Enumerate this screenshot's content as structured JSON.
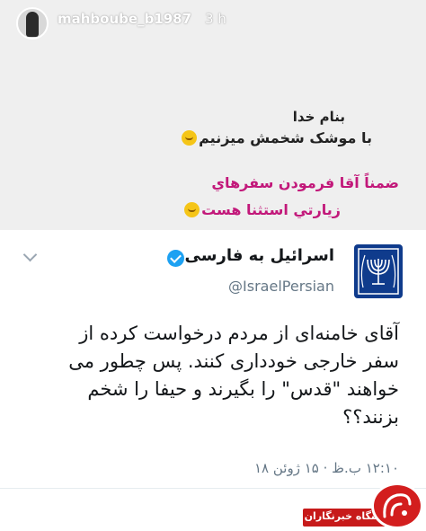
{
  "story": {
    "username": "mahboube_b1987",
    "time": "3 h"
  },
  "caption": {
    "line1": "بنام خدا",
    "line2": "با موشک شخمش میزنیم",
    "line3": "ضمناً آقا فرمودن سفرهاي",
    "line4": "زيارتي استثنا هست"
  },
  "tweet": {
    "name": "اسرائیل به فارسی",
    "handle": "@IsraelPersian",
    "body_lines": [
      "آقای خامنه‌ای از مردم درخواست کرده از",
      "سفر خارجی خودداری کنند. پس چطور می",
      "خواهند \"قدس\" را بگیرند و حیفا را شخم",
      "بزنند؟؟"
    ],
    "meta": "۱۲:۱۰ ب.ظ · ۱۵ ژوئن ۱۸"
  },
  "watermark": {
    "label": "باشگاه خبرنگاران"
  },
  "colors": {
    "caption_pink": "#c2187a",
    "verified_blue": "#1da1f2",
    "logo_blue": "#0f3b8c",
    "watermark_red": "#d31e1e"
  },
  "icons": {
    "avatar": "avatar",
    "verified": "verified-badge-icon",
    "chevron": "chevron-down-icon",
    "logo": "menorah-emblem-icon",
    "emoji": "smiling-face-emoji-icon"
  }
}
